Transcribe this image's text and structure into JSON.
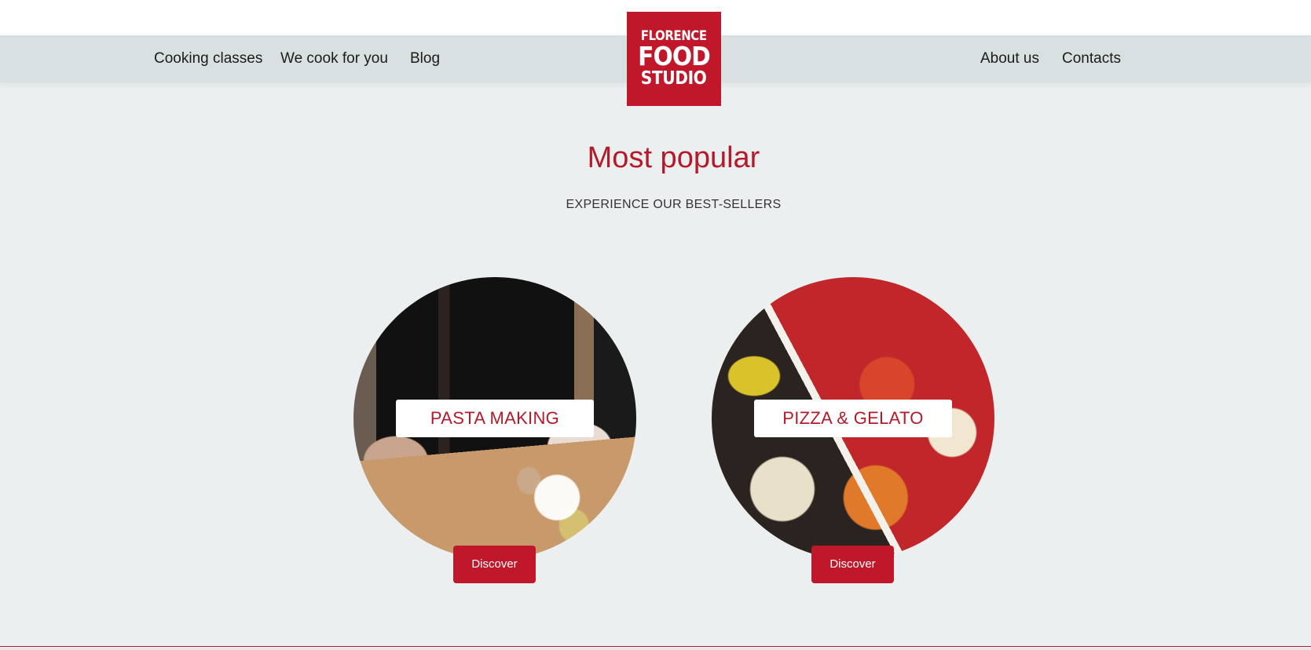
{
  "header": {
    "nav_left": [
      {
        "label": "Cooking classes"
      },
      {
        "label": "We cook for you"
      },
      {
        "label": "Blog"
      }
    ],
    "nav_right": [
      {
        "label": "About us"
      },
      {
        "label": "Contacts"
      }
    ],
    "logo": {
      "line1": "FLORENCE",
      "line2": "FOOD",
      "line3": "STUDIO"
    }
  },
  "section": {
    "title": "Most popular",
    "subtitle": "EXPERIENCE OUR BEST-SELLERS"
  },
  "cards": [
    {
      "label": "PASTA MAKING",
      "button": "Discover",
      "image_icon": "pasta-making-photo"
    },
    {
      "label": "PIZZA & GELATO",
      "button": "Discover",
      "image_icon": "pizza-gelato-photo"
    }
  ],
  "colors": {
    "brand_red": "#c0182a",
    "nav_bg": "#d9e0e2",
    "page_bg": "#eceff0"
  }
}
